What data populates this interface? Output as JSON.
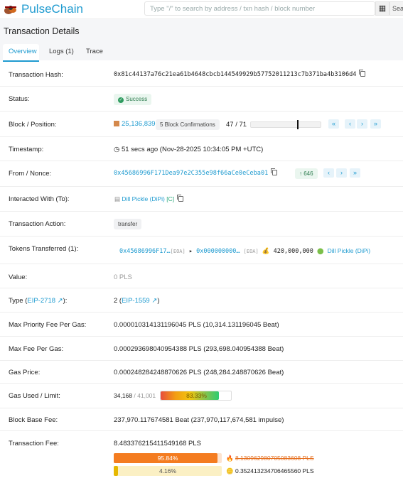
{
  "header": {
    "brand": "PulseChain",
    "search_placeholder": "Type \"/\" to search by address / txn hash / block number",
    "search_button": "Sea",
    "qr_icon": "qr-code-icon"
  },
  "page": {
    "title": "Transaction Details",
    "tabs": [
      {
        "label": "Overview"
      },
      {
        "label": "Logs (1)"
      },
      {
        "label": "Trace"
      }
    ]
  },
  "details": {
    "hash": {
      "label": "Transaction Hash:",
      "value": "0x81c44137a76c21ea61b4648cbcb144549929b57752011213c7b371ba4b3106d4"
    },
    "status": {
      "label": "Status:",
      "value": "Success"
    },
    "block": {
      "label": "Block / Position:",
      "number": "25,136,839",
      "confirmations": "5 Block Confirmations",
      "position": "47 / 71",
      "position_fraction": 0.66
    },
    "timestamp": {
      "label": "Timestamp:",
      "value": "51 secs ago (Nov-28-2025 10:34:05 PM +UTC)"
    },
    "from": {
      "label": "From / Nonce:",
      "address": "0x45686996F171Dea97e2C355e98f66aCe0eCeba01",
      "nonce": "646"
    },
    "interacted": {
      "label": "Interacted With (To):",
      "name": "Dill Pickle (DiPi)",
      "badge": "[C]"
    },
    "action": {
      "label": "Transaction Action:",
      "value": "transfer"
    },
    "tokens": {
      "label": "Tokens Transferred (1):",
      "from": "0x45686996F17…",
      "from_tag": "[EOA]",
      "to": "0x000000000…",
      "to_tag": "[EOA]",
      "amount": "420,000,000",
      "token": "Dill Pickle (DiPi)"
    },
    "value": {
      "label": "Value:",
      "value": "0 PLS"
    },
    "type": {
      "label_prefix": "Type (",
      "label_link": "EIP-2718",
      "label_suffix": "):",
      "value_prefix": "2 (",
      "value_link": "EIP-1559",
      "value_suffix": ")"
    },
    "max_priority": {
      "label": "Max Priority Fee Per Gas:",
      "value": "0.000010314131196045 PLS (10,314.131196045 Beat)"
    },
    "max_fee": {
      "label": "Max Fee Per Gas:",
      "value": "0.000293698040954388 PLS (293,698.040954388 Beat)"
    },
    "gas_price": {
      "label": "Gas Price:",
      "value": "0.000248284248870626 PLS (248,284.248870626 Beat)"
    },
    "gas_used": {
      "label": "Gas Used / Limit:",
      "used": "34,168",
      "limit": "41,001",
      "percent": "83.33%",
      "fraction": 0.8333
    },
    "base_fee": {
      "label": "Block Base Fee:",
      "value": "237,970.117674581 Beat (237,970,117,674,581 impulse)"
    },
    "fee": {
      "label": "Transaction Fee:",
      "value": "8.483376215411549168 PLS",
      "burnt_percent": "95.84%",
      "burnt_fraction": 0.9584,
      "burnt_value": "8.130962980705083608 PLS",
      "tip_percent": "4.16%",
      "tip_fraction": 0.0416,
      "tip_value": "0.352413234706465560 PLS"
    }
  },
  "colors": {
    "accent": "#1f9bd0",
    "success": "#2e7d4f",
    "burn": "#f47c20",
    "tip": "#f5d23a"
  }
}
